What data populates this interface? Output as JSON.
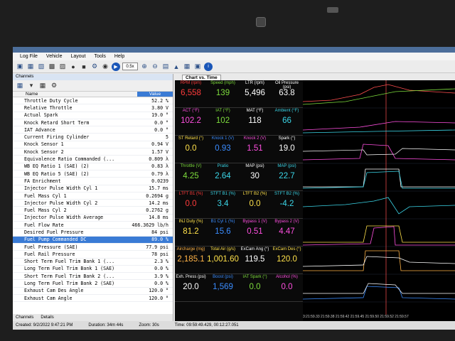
{
  "menu": [
    "Log File",
    "Vehicle",
    "Layout",
    "Tools",
    "Help"
  ],
  "toolbar": {
    "zoom": "0.5x"
  },
  "channels": {
    "header": "Channels",
    "col_name": "Name",
    "col_value": "Value",
    "rows": [
      {
        "name": "Throttle Duty Cycle",
        "value": "52.2 %"
      },
      {
        "name": "Relative Throttle",
        "value": "3.80 V"
      },
      {
        "name": "Actual Spark",
        "value": "19.0 °"
      },
      {
        "name": "Knock Retard Short Term",
        "value": "0.0 °"
      },
      {
        "name": "IAT Advance",
        "value": "0.0 °"
      },
      {
        "name": "Current Firing Cylinder",
        "value": "5"
      },
      {
        "name": "Knock Sensor 1",
        "value": "0.94 V"
      },
      {
        "name": "Knock Sensor 2",
        "value": "1.57 V"
      },
      {
        "name": "Equivalence Ratio Commanded (...",
        "value": "0.809 λ"
      },
      {
        "name": "WB EQ Ratio 1 (SAE) (2)",
        "value": "0.83 λ"
      },
      {
        "name": "WB EQ Ratio 5 (SAE) (2)",
        "value": "0.79 λ"
      },
      {
        "name": "FA Enrichment",
        "value": "0.0239"
      },
      {
        "name": "Injector Pulse Width Cyl 1",
        "value": "15.7 ms"
      },
      {
        "name": "Fuel Mass Cyl 1",
        "value": "0.2694 g"
      },
      {
        "name": "Injector Pulse Width Cyl 2",
        "value": "14.2 ms"
      },
      {
        "name": "Fuel Mass Cyl 2",
        "value": "0.2762 g"
      },
      {
        "name": "Injector Pulse Width Average",
        "value": "14.8 ms"
      },
      {
        "name": "Fuel Flow Rate",
        "value": "466.3629 lb/h"
      },
      {
        "name": "Desired Fuel Pressure",
        "value": "84 psi"
      },
      {
        "name": "Fuel Pump Commanded DC",
        "value": "89.0 %"
      },
      {
        "name": "Fuel Pressure (SAE)",
        "value": "77.9 psi"
      },
      {
        "name": "Fuel Rail Pressure",
        "value": "78 psi"
      },
      {
        "name": "Short Term Fuel Trim Bank 1 (...",
        "value": "2.3 %"
      },
      {
        "name": "Long Term Fuel Trim Bank 1 (SAE)",
        "value": "0.0 %"
      },
      {
        "name": "Short Term Fuel Trim Bank 2 (...",
        "value": "3.9 %"
      },
      {
        "name": "Long Term Fuel Trim Bank 2 (SAE)",
        "value": "0.0 %"
      },
      {
        "name": "Exhaust Cam Des Angle",
        "value": "120.0 °"
      },
      {
        "name": "Exhaust Cam Angle",
        "value": "120.0 °"
      }
    ],
    "selected_index": 19,
    "tabs": [
      "Channels",
      "Details"
    ]
  },
  "chart": {
    "tab": "Chart vs. Time",
    "gauges": [
      [
        {
          "label": "RPM (rpm)",
          "value": "6,558",
          "color": "#ff3b3b"
        },
        {
          "label": "Speed (mph)",
          "value": "139",
          "color": "#7ddc3c"
        },
        {
          "label": "LTR (rpm)",
          "value": "5,496",
          "color": "#ffffff"
        },
        {
          "label": "Oil Pressure (psi)",
          "value": "63.8",
          "color": "#ffffff"
        }
      ],
      [
        {
          "label": "ACT (°F)",
          "value": "102.2",
          "color": "#ff4fe0"
        },
        {
          "label": "IAT (°F)",
          "value": "102",
          "color": "#7ddc3c"
        },
        {
          "label": "MAT (°F)",
          "value": "118",
          "color": "#ffffff"
        },
        {
          "label": "Ambient (°F)",
          "value": "66",
          "color": "#3bd6e8"
        }
      ],
      [
        {
          "label": "ST Retard (°)",
          "value": "0.0",
          "color": "#ffe14a"
        },
        {
          "label": "Knock 1 (V)",
          "value": "0.93",
          "color": "#3b8dff"
        },
        {
          "label": "Knock 2 (V)",
          "value": "1.51",
          "color": "#ff4fe0"
        },
        {
          "label": "Spark (°)",
          "value": "19.0",
          "color": "#ffffff"
        }
      ],
      [
        {
          "label": "Throttle (V)",
          "value": "4.25",
          "color": "#7ddc3c"
        },
        {
          "label": "Pratio",
          "value": "2.64",
          "color": "#3bd6e8"
        },
        {
          "label": "MAP (psi)",
          "value": "30",
          "color": "#ffffff"
        },
        {
          "label": "MAP (psi)",
          "value": "22.7",
          "color": "#3bd6e8"
        }
      ],
      [
        {
          "label": "LTFT B1 (%)",
          "value": "0.0",
          "color": "#ff3b3b"
        },
        {
          "label": "STFT B1 (%)",
          "value": "3.4",
          "color": "#3bd6e8"
        },
        {
          "label": "LTFT B2 (%)",
          "value": "0.0",
          "color": "#ffe14a"
        },
        {
          "label": "STFT B2 (%)",
          "value": "-4.2",
          "color": "#3bd6e8"
        }
      ],
      [
        {
          "label": "INJ Duty (%)",
          "value": "81.2",
          "color": "#ffe14a"
        },
        {
          "label": "B1 Cyl 1 (%)",
          "value": "15.6",
          "color": "#3b8dff"
        },
        {
          "label": "Bypass 1 (V)",
          "value": "0.51",
          "color": "#ff4fe0"
        },
        {
          "label": "Bypass 2 (V)",
          "value": "4.47",
          "color": "#ff4fe0"
        }
      ],
      [
        {
          "label": "Aircharge (mg)",
          "value": "2,185.1",
          "color": "#ffb347"
        },
        {
          "label": "Total Air (g/s)",
          "value": "1,001.60",
          "color": "#ffe14a"
        },
        {
          "label": "ExCam Ang (°)",
          "value": "119.5",
          "color": "#ffffff"
        },
        {
          "label": "ExCam Des (°)",
          "value": "120.0",
          "color": "#ffe14a"
        }
      ],
      [
        {
          "label": "Exh. Press (psi)",
          "value": "20.0",
          "color": "#ffffff"
        },
        {
          "label": "Boost (psi)",
          "value": "1,569",
          "color": "#3b8dff"
        },
        {
          "label": "IAT Spark (°)",
          "value": "0.0",
          "color": "#7ddc3c"
        },
        {
          "label": "Alcohol (%)",
          "value": "0.0",
          "color": "#ff4fe0"
        }
      ]
    ],
    "timeline": "3:21:59.33 21:59.38 21:59.42 21:59.45 21:59.50 21:59.52 21:59.57"
  },
  "status": {
    "created": "Created: 9/2/2022 9:47:21 PM",
    "duration": "Duration: 34m 44s",
    "zoom": "Zoom: 30s",
    "time": "Time: 09:59:49.429, 00:12:27.051"
  }
}
